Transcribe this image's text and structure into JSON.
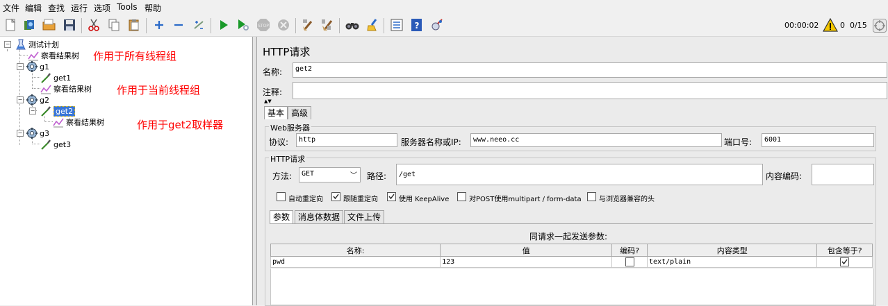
{
  "menu": [
    "文件",
    "编辑",
    "查找",
    "运行",
    "选项",
    "Tools",
    "帮助"
  ],
  "toolbar": {
    "icons": [
      "new-icon",
      "templates-icon",
      "open-icon",
      "save-icon",
      "cut-icon",
      "copy-icon",
      "paste-icon",
      "expand-icon",
      "collapse-icon",
      "toggle-icon",
      "start-icon",
      "start-no-pause-icon",
      "stop-icon",
      "shutdown-icon",
      "clear-icon",
      "clear-all-icon",
      "search-icon",
      "reset-search-icon",
      "function-helper-icon",
      "help-icon",
      "remote-icon"
    ],
    "timer": "00:00:02",
    "error_count": "0",
    "threads": "0/15"
  },
  "tree": {
    "root": "测试计划",
    "root_listener": "察看结果树",
    "g1": "g1",
    "g1_sampler": "get1",
    "g1_listener": "察看结果树",
    "g2": "g2",
    "g2_sampler": "get2",
    "g2_listener": "察看结果树",
    "g3": "g3",
    "g3_sampler": "get3"
  },
  "annotations": {
    "all_groups": "作用于所有线程组",
    "current_group": "作用于当前线程组",
    "sampler": "作用于get2取样器"
  },
  "panel": {
    "title": "HTTP请求",
    "name_label": "名称:",
    "name_value": "get2",
    "comment_label": "注释:",
    "comment_value": "",
    "tabs": [
      "基本",
      "高级"
    ],
    "web_server": {
      "title": "Web服务器",
      "protocol_label": "协议:",
      "protocol_value": "http",
      "server_label": "服务器名称或IP:",
      "server_value": "www.neeo.cc",
      "port_label": "端口号:",
      "port_value": "6001"
    },
    "http_request": {
      "title": "HTTP请求",
      "method_label": "方法:",
      "method_value": "GET",
      "path_label": "路径:",
      "path_value": "/get",
      "encoding_label": "内容编码:",
      "encoding_value": ""
    },
    "options": [
      {
        "label": "自动重定向",
        "checked": false
      },
      {
        "label": "跟随重定向",
        "checked": true
      },
      {
        "label": "使用 KeepAlive",
        "checked": true
      },
      {
        "label": "对POST使用multipart / form-data",
        "checked": false
      },
      {
        "label": "与浏览器兼容的头",
        "checked": false
      }
    ],
    "sub_tabs": [
      "参数",
      "消息体数据",
      "文件上传"
    ],
    "params_caption": "同请求一起发送参数:",
    "columns": [
      "名称:",
      "值",
      "编码?",
      "内容类型",
      "包含等于?"
    ],
    "rows": [
      {
        "name": "pwd",
        "value": "123",
        "encode": false,
        "content_type": "text/plain",
        "include_equals": true
      }
    ]
  },
  "colors": {
    "annotation": "#ff0000",
    "selection": "#3875d7",
    "start_green": "#1a9a2a"
  }
}
